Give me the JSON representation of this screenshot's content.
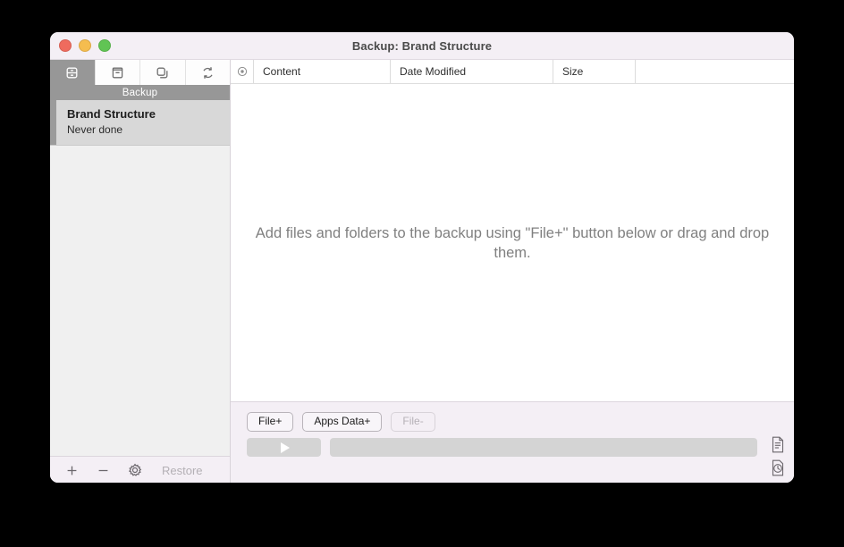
{
  "window": {
    "title": "Backup: Brand Structure",
    "traffic_lights": [
      "close-button",
      "minimize-button",
      "zoom-button"
    ]
  },
  "sidebar": {
    "tabs": [
      {
        "name": "backup-tab",
        "icon": "drive-icon",
        "active": true
      },
      {
        "name": "archive-tab",
        "icon": "archive-box-icon",
        "active": false
      },
      {
        "name": "clone-tab",
        "icon": "copy-squares-icon",
        "active": false
      },
      {
        "name": "sync-tab",
        "icon": "sync-arrows-icon",
        "active": false
      }
    ],
    "group_label": "Backup",
    "items": [
      {
        "title": "Brand Structure",
        "subtitle": "Never done",
        "selected": true
      }
    ],
    "footer": {
      "add_label": "+",
      "remove_label": "−",
      "settings_icon": "gear-icon",
      "restore_label": "Restore",
      "restore_enabled": false
    }
  },
  "main": {
    "columns": [
      {
        "key": "icon",
        "label": ""
      },
      {
        "key": "content",
        "label": "Content"
      },
      {
        "key": "date_modified",
        "label": "Date Modified"
      },
      {
        "key": "size",
        "label": "Size"
      },
      {
        "key": "extra",
        "label": ""
      }
    ],
    "rows": [],
    "empty_message": "Add files and folders to the backup using \"File+\" button below or drag and drop them.",
    "action_buttons": [
      {
        "label": "File+",
        "enabled": true
      },
      {
        "label": "Apps Data+",
        "enabled": true
      },
      {
        "label": "File-",
        "enabled": false
      }
    ],
    "transport": {
      "play_label": "▶",
      "progress_percent": 0,
      "log_icon": "document-log-icon",
      "history_icon": "clock-history-icon"
    }
  },
  "colors": {
    "chrome": "#f4eff5",
    "accent_bar": "#9b9b9b",
    "selection": "#d8d8d8",
    "group_header": "#979797",
    "track": "#d4d4d4"
  }
}
